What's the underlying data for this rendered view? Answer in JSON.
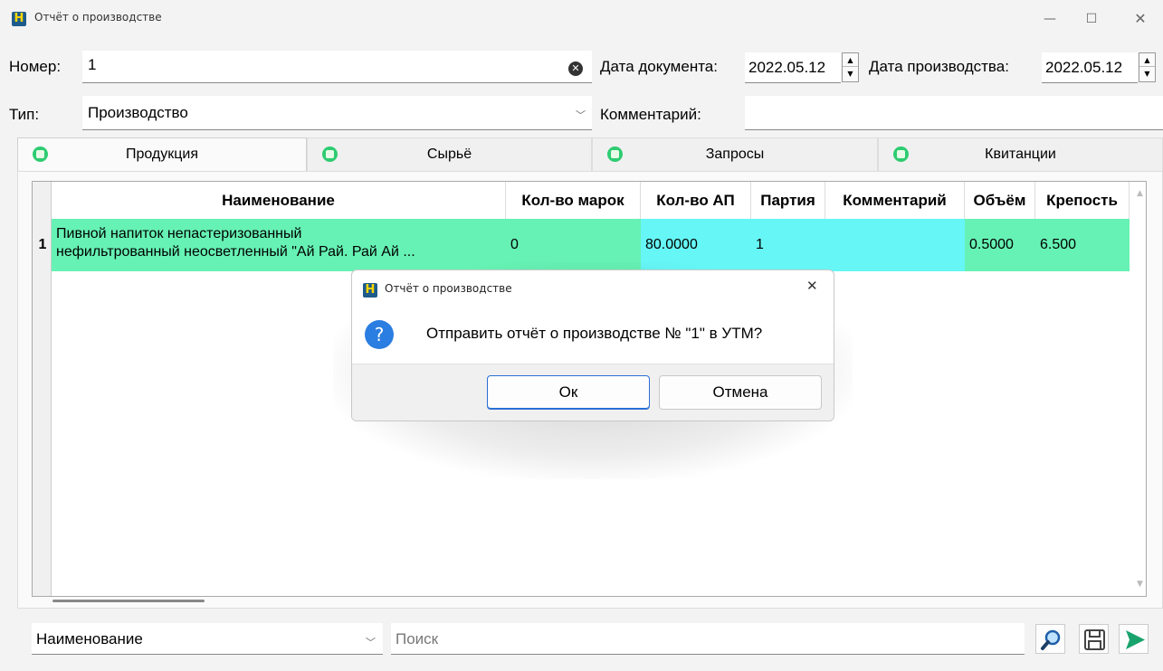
{
  "window": {
    "app_icon": "H",
    "title": "Отчёт о производстве",
    "controls": {
      "minimize": "—",
      "maximize": "☐",
      "close": "✕"
    }
  },
  "form": {
    "number_label": "Номер:",
    "number_value": "1",
    "doc_date_label": "Дата документа:",
    "doc_date_value": "2022.05.12",
    "prod_date_label": "Дата производства:",
    "prod_date_value": "2022.05.12",
    "type_label": "Тип:",
    "type_value": "Производство",
    "comment_label": "Комментарий:",
    "comment_value": ""
  },
  "tabs": [
    {
      "label": "Продукция"
    },
    {
      "label": "Сырьё"
    },
    {
      "label": "Запросы"
    },
    {
      "label": "Квитанции"
    }
  ],
  "table": {
    "columns": [
      "Наименование",
      "Кол-во марок",
      "Кол-во АП",
      "Партия",
      "Комментарий",
      "Объём",
      "Крепость"
    ],
    "rows": [
      {
        "num": "1",
        "name_line1": "Пивной напиток непастеризованный",
        "name_line2": "нефильтрованный неосветленный \"Ай Рай. Рай Ай ...",
        "marks": "0",
        "ap": "80.0000",
        "batch": "1",
        "comment": "",
        "volume": "0.5000",
        "strength": "6.500"
      }
    ]
  },
  "bottom": {
    "field_select": "Наименование",
    "search_placeholder": "Поиск"
  },
  "dialog": {
    "app_icon": "H",
    "title": "Отчёт о производстве",
    "close": "✕",
    "icon": "?",
    "message": "Отправить отчёт о производстве № \"1\" в УТМ?",
    "ok": "Ок",
    "cancel": "Отмена"
  },
  "icons": {
    "clear": "clear-icon",
    "spin_up": "▲",
    "spin_down": "▼",
    "combo": "﹀",
    "search_tool": "magnifier-icon",
    "save_tool": "floppy-disk-icon",
    "send_tool": "send-arrow-icon"
  },
  "colors": {
    "row_green": "#66f2b4",
    "row_cyan": "#66f6f6",
    "tab_icon": "#2ecc71",
    "dialog_icon": "#2a7de1",
    "send_arrow": "#17a36b"
  }
}
